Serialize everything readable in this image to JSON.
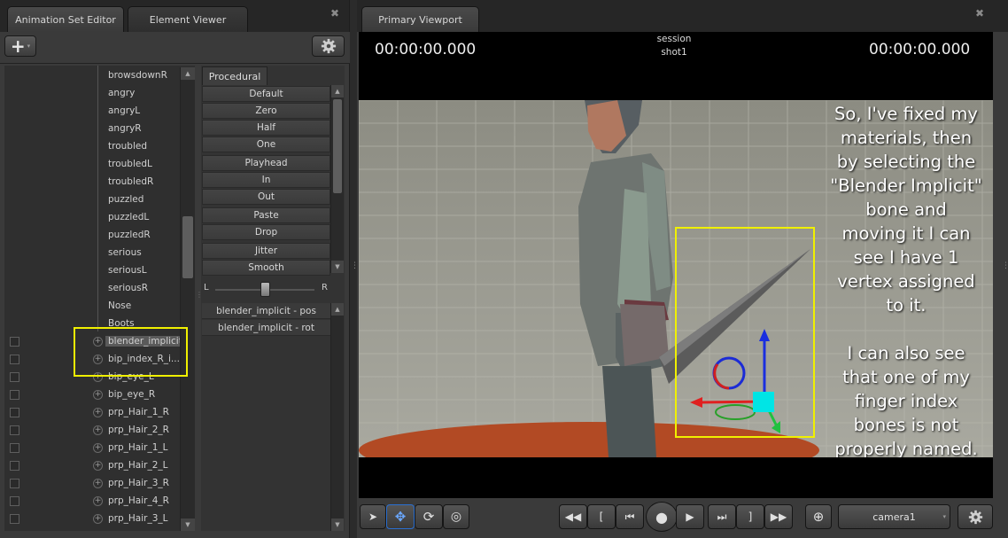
{
  "left_panel": {
    "tabs": [
      "Animation Set Editor",
      "Element Viewer"
    ],
    "close_glyph": "✖",
    "add_label": "+",
    "tree_items": [
      {
        "label": "browsdownR",
        "checkbox": false
      },
      {
        "label": "angry",
        "checkbox": false
      },
      {
        "label": "angryL",
        "checkbox": false
      },
      {
        "label": "angryR",
        "checkbox": false
      },
      {
        "label": "troubled",
        "checkbox": false
      },
      {
        "label": "troubledL",
        "checkbox": false
      },
      {
        "label": "troubledR",
        "checkbox": false
      },
      {
        "label": "puzzled",
        "checkbox": false
      },
      {
        "label": "puzzledL",
        "checkbox": false
      },
      {
        "label": "puzzledR",
        "checkbox": false
      },
      {
        "label": "serious",
        "checkbox": false
      },
      {
        "label": "seriousL",
        "checkbox": false
      },
      {
        "label": "seriousR",
        "checkbox": false
      },
      {
        "label": "Nose",
        "checkbox": false
      },
      {
        "label": "Boots",
        "checkbox": false
      },
      {
        "label": "blender_implicit",
        "checkbox": true,
        "selected": true
      },
      {
        "label": "bip_index_R_i...",
        "checkbox": true
      },
      {
        "label": "bip_eye_L",
        "checkbox": true
      },
      {
        "label": "bip_eye_R",
        "checkbox": true
      },
      {
        "label": "prp_Hair_1_R",
        "checkbox": true
      },
      {
        "label": "prp_Hair_2_R",
        "checkbox": true
      },
      {
        "label": "prp_Hair_1_L",
        "checkbox": true
      },
      {
        "label": "prp_Hair_2_L",
        "checkbox": true
      },
      {
        "label": "prp_Hair_3_R",
        "checkbox": true
      },
      {
        "label": "prp_Hair_4_R",
        "checkbox": true
      },
      {
        "label": "prp_Hair_3_L",
        "checkbox": true
      }
    ]
  },
  "procedural": {
    "tab": "Procedural",
    "groups": [
      [
        "Default",
        "Zero",
        "Half",
        "One"
      ],
      [
        "Playhead",
        "In",
        "Out"
      ],
      [
        "Paste",
        "Drop"
      ],
      [
        "Jitter",
        "Smooth"
      ]
    ],
    "slider_left": "L",
    "slider_right": "R",
    "channels": [
      "blender_implicit - pos",
      "blender_implicit - rot"
    ]
  },
  "viewport": {
    "tab": "Primary Viewport",
    "time_left": "00:00:00.000",
    "time_right": "00:00:00.000",
    "session": "session",
    "shot": "shot1",
    "caption_lines": [
      "So, I've fixed my",
      "materials, then",
      "by selecting the",
      "\"Blender Implicit\"",
      "bone and",
      "moving it I can",
      "see I have 1",
      "vertex assigned",
      "to it.",
      "",
      "I can also see",
      "that one of my",
      "finger index",
      "bones is not",
      "properly named."
    ],
    "camera_label": "camera1"
  },
  "colors": {
    "highlight": "#f0f000",
    "accent_cyan": "#00e5e5"
  }
}
